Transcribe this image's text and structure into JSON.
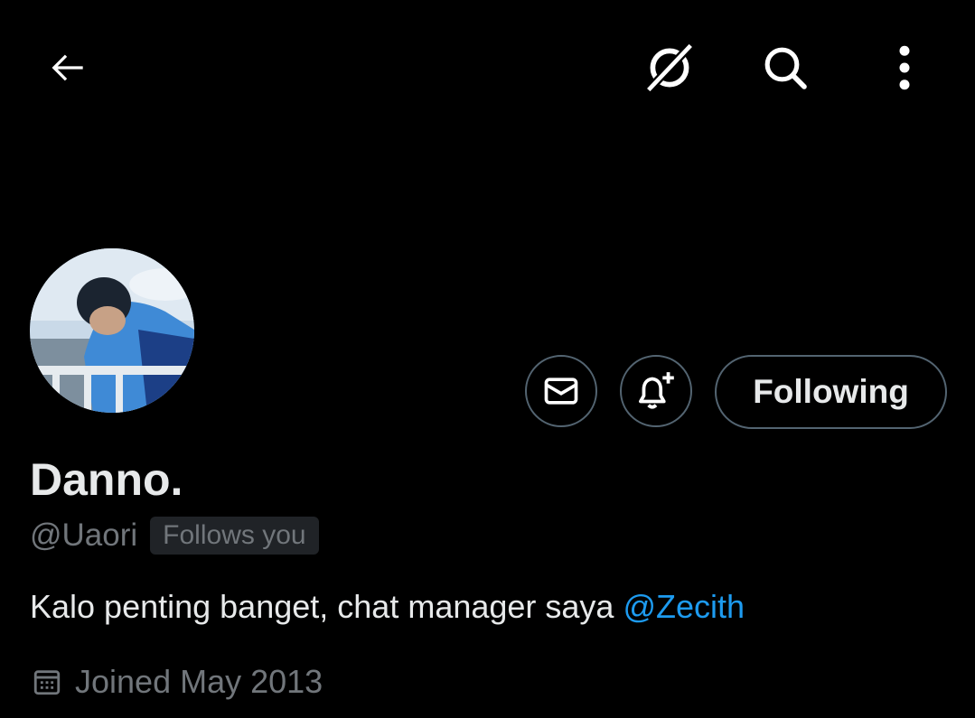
{
  "topbar": {
    "back_icon": "arrow-left-icon",
    "grok_icon": "grok-icon",
    "search_icon": "search-icon",
    "more_icon": "more-vertical-icon"
  },
  "profile": {
    "display_name": "Danno.",
    "handle": "@Uaori",
    "follows_you_badge": "Follows you",
    "bio_text": "Kalo penting banget, chat manager saya ",
    "bio_mention": "@Zecith",
    "joined_text": "Joined May 2013"
  },
  "actions": {
    "message_icon": "envelope-icon",
    "notify_icon": "bell-plus-icon",
    "following_label": "Following"
  },
  "colors": {
    "background": "#000000",
    "text_primary": "#e7e9ea",
    "text_secondary": "#71767b",
    "border": "#536471",
    "accent": "#1d9bf0",
    "badge_bg": "#202327"
  }
}
